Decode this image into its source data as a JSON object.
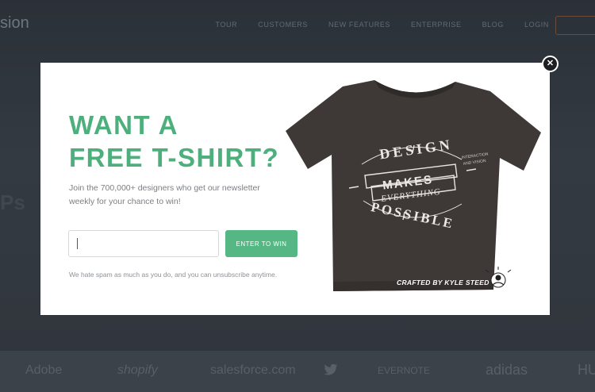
{
  "background": {
    "logo_text": "sion",
    "nav": [
      "TOUR",
      "CUSTOMERS",
      "NEW FEATURES",
      "ENTERPRISE",
      "BLOG",
      "LOGIN"
    ],
    "left_text": "Ps",
    "client_logos": [
      "Adobe",
      "shopify",
      "salesforce.com",
      "twitter",
      "EVERNOTE",
      "adidas",
      "HU"
    ]
  },
  "modal": {
    "close_label": "✕",
    "headline_line1": "WANT A",
    "headline_line2": "FREE T-SHIRT?",
    "subtext": "Join the 700,000+ designers who get our newsletter weekly for your chance to win!",
    "email_value": "",
    "submit_label": "ENTER TO WIN",
    "disclaimer": "We hate spam as much as you do, and you can unsubscribe anytime."
  },
  "shirt": {
    "line_design": "DESIGN",
    "line_makes": "MAKES",
    "line_everything": "EVERYTHING",
    "line_possible": "POSSIBLE",
    "side_text_1": "INTERACTION",
    "side_text_2": "AND VISION",
    "credit": "CRAFTED BY KYLE STEED"
  },
  "colors": {
    "accent": "#55b884",
    "headline": "#4daf7c",
    "shirt": "#3e3936"
  }
}
